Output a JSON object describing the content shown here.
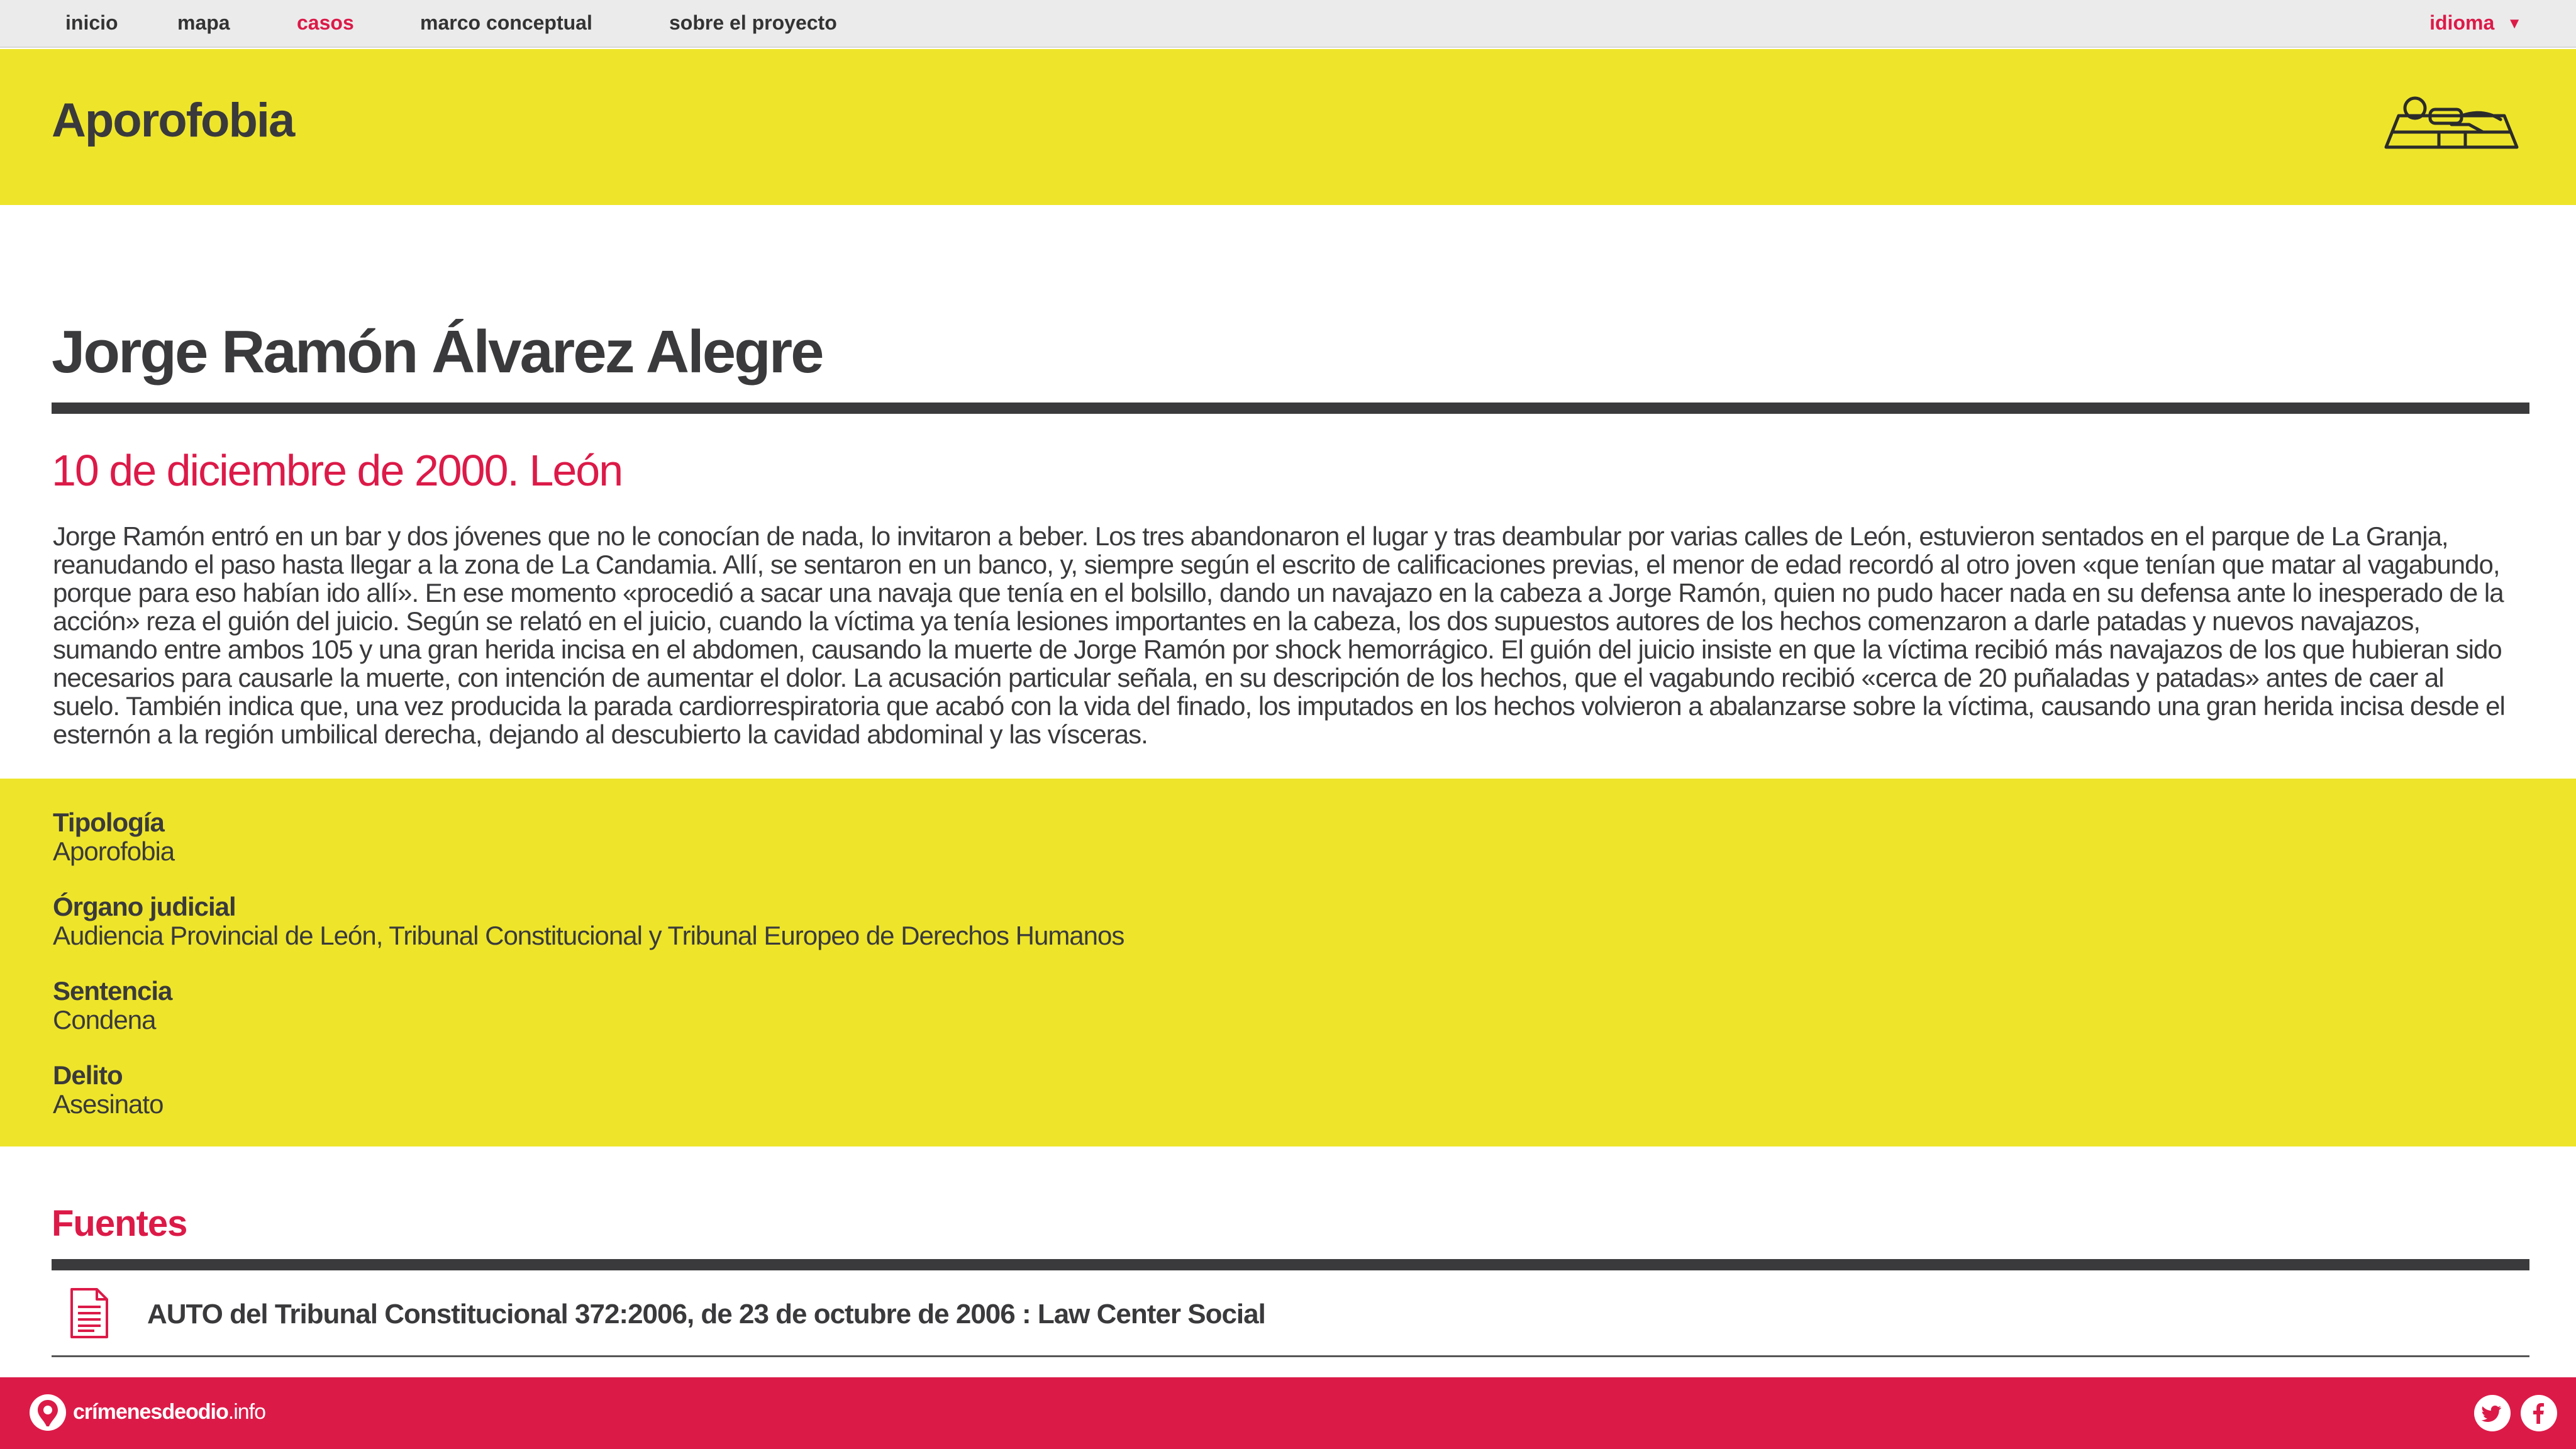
{
  "nav": {
    "items": [
      "inicio",
      "mapa",
      "casos",
      "marco conceptual",
      "sobre el proyecto"
    ],
    "active": "casos",
    "language_label": "idioma"
  },
  "header": {
    "category": "Aporofobia",
    "icon": "sleeping-person-on-bench-icon"
  },
  "case": {
    "name": "Jorge Ramón Álvarez Alegre",
    "date_place": "10 de diciembre de 2000. León",
    "description": "Jorge Ramón entró en un bar y dos jóvenes que no le conocían de nada, lo invitaron a beber. Los tres abandonaron el lugar y tras deambular por varias calles de León, estuvieron sentados en el parque de La Granja, reanudando el paso hasta llegar a la zona de La Candamia. Allí, se sentaron en un banco, y, siempre según el escrito de calificaciones previas, el menor de edad recordó al otro joven «que tenían que matar al vagabundo, porque para eso habían ido allí». En ese momento «procedió a sacar una navaja que tenía en el bolsillo, dando un navajazo en la cabeza a Jorge Ramón, quien no pudo hacer nada en su defensa ante lo inesperado de la acción» reza el guión del juicio. Según  se relató en el juicio, cuando la víctima ya tenía lesiones importantes en la cabeza, los dos supuestos autores de los hechos comenzaron a darle patadas y nuevos navajazos, sumando entre ambos 105 y una gran herida incisa en el abdomen, causando la muerte de Jorge Ramón por shock hemorrágico. El guión del juicio insiste en que la víctima recibió más navajazos de los que hubieran sido necesarios para causarle la muerte, con intención de aumentar el dolor. La acusación particular señala, en su descripción de los hechos, que el vagabundo recibió «cerca de 20 puñaladas y patadas» antes de caer al suelo. También indica que, una vez producida la parada cardiorrespiratoria que acabó con la vida del finado, los imputados en los hechos volvieron a abalanzarse sobre la víctima, causando una gran herida incisa desde el esternón a la región umbilical derecha, dejando al descubierto la cavidad abdominal y las vísceras."
  },
  "facts": [
    {
      "label": "Tipología",
      "value": "Aporofobia"
    },
    {
      "label": "Órgano judicial",
      "value": "Audiencia Provincial de León, Tribunal Constitucional y Tribunal Europeo de Derechos Humanos"
    },
    {
      "label": "Sentencia",
      "value": "Condena"
    },
    {
      "label": "Delito",
      "value": "Asesinato"
    }
  ],
  "sources": {
    "title": "Fuentes",
    "items": [
      {
        "text": "AUTO del Tribunal Constitucional 372:2006, de 23 de octubre de 2006 : Law Center Social",
        "icon": "document-icon"
      }
    ]
  },
  "footer": {
    "brand_bold": "crímenesdeodio",
    "brand_suffix": ".info",
    "social": [
      "twitter-icon",
      "facebook-icon"
    ]
  },
  "colors": {
    "accent": "#dc1a48",
    "yellow": "#eee52b",
    "text": "#3a3a3c",
    "nav_bg": "#ebebec"
  }
}
